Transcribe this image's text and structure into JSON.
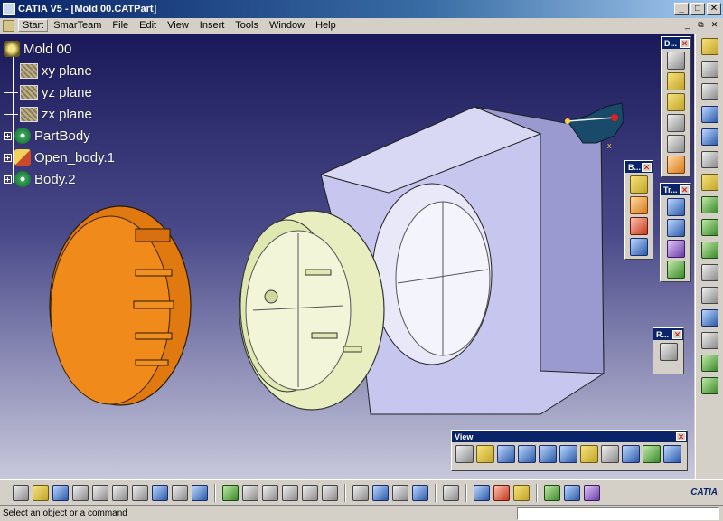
{
  "window": {
    "title": "CATIA V5 - [Mold 00.CATPart]",
    "buttons": {
      "minimize": "_",
      "maximize": "□",
      "close": "✕"
    }
  },
  "menu": {
    "items": [
      "Start",
      "SmarTeam",
      "File",
      "Edit",
      "View",
      "Insert",
      "Tools",
      "Window",
      "Help"
    ],
    "doc_controls": {
      "minimize": "_",
      "restore": "⧉",
      "close": "✕"
    }
  },
  "tree": {
    "root": "Mold 00",
    "children": [
      "xy plane",
      "yz plane",
      "zx plane",
      "PartBody",
      "Open_body.1",
      "Body.2"
    ]
  },
  "toolbars": {
    "d": {
      "label": "D...",
      "close": "✕"
    },
    "b": {
      "label": "B...",
      "close": "✕"
    },
    "tr": {
      "label": "Tr...",
      "close": "✕"
    },
    "r": {
      "label": "R...",
      "close": "✕"
    },
    "view": {
      "label": "View",
      "close": "✕"
    }
  },
  "brand": {
    "logo": "CATIA"
  },
  "status": {
    "message": "Select an object or a command",
    "command_value": ""
  },
  "colors": {
    "accent": "#0a246a",
    "orange_part": "#e07a10",
    "green_part": "#e8eec0",
    "mold_block": "#c6c6ee"
  }
}
